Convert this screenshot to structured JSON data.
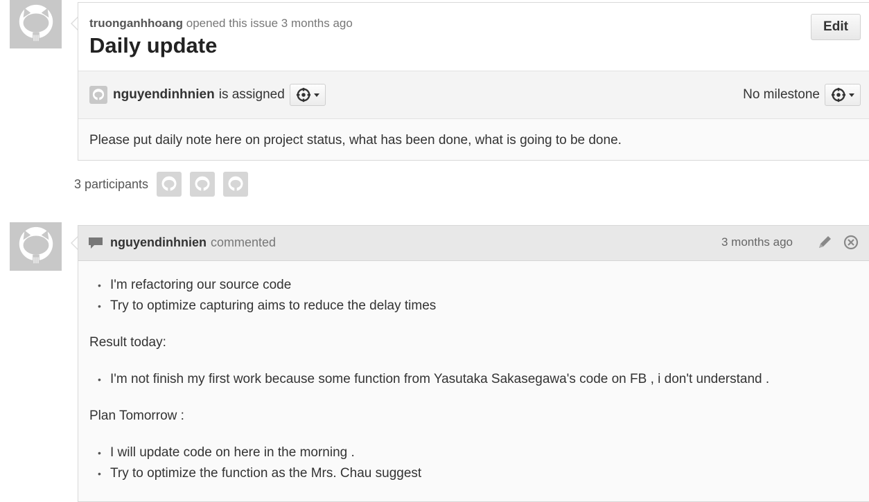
{
  "issue": {
    "author": "truonganhhoang",
    "opened_text": "opened this issue 3 months ago",
    "title": "Daily update",
    "edit_label": "Edit",
    "assignee": "nguyendinhnien",
    "assigned_text": "is assigned",
    "milestone_text": "No milestone",
    "body": "Please put daily note here on project status, what has been done, what is going to be done."
  },
  "participants": {
    "label": "3 participants",
    "count": 3
  },
  "comment": {
    "author": "nguyendinhnien",
    "action": "commented",
    "time": "3 months ago",
    "list1": [
      "I'm refactoring our source code",
      "Try to optimize capturing aims to reduce the delay times"
    ],
    "result_heading": "Result today:",
    "list2": [
      "I'm not finish my first work because some function from Yasutaka Sakasegawa's code on FB , i don't understand ."
    ],
    "plan_heading": "Plan Tomorrow :",
    "list3": [
      "I will update code on here in the morning .",
      "Try to optimize the function as the Mrs. Chau suggest"
    ]
  },
  "icons": {
    "avatar": "octocat-icon",
    "settings": "gear-icon",
    "comment": "speech-bubble-icon",
    "edit": "pencil-icon",
    "delete": "close-circle-icon"
  },
  "colors": {
    "avatar_bg": "#c8c8c8",
    "header_bg": "#e8e8e8",
    "text": "#333333"
  }
}
